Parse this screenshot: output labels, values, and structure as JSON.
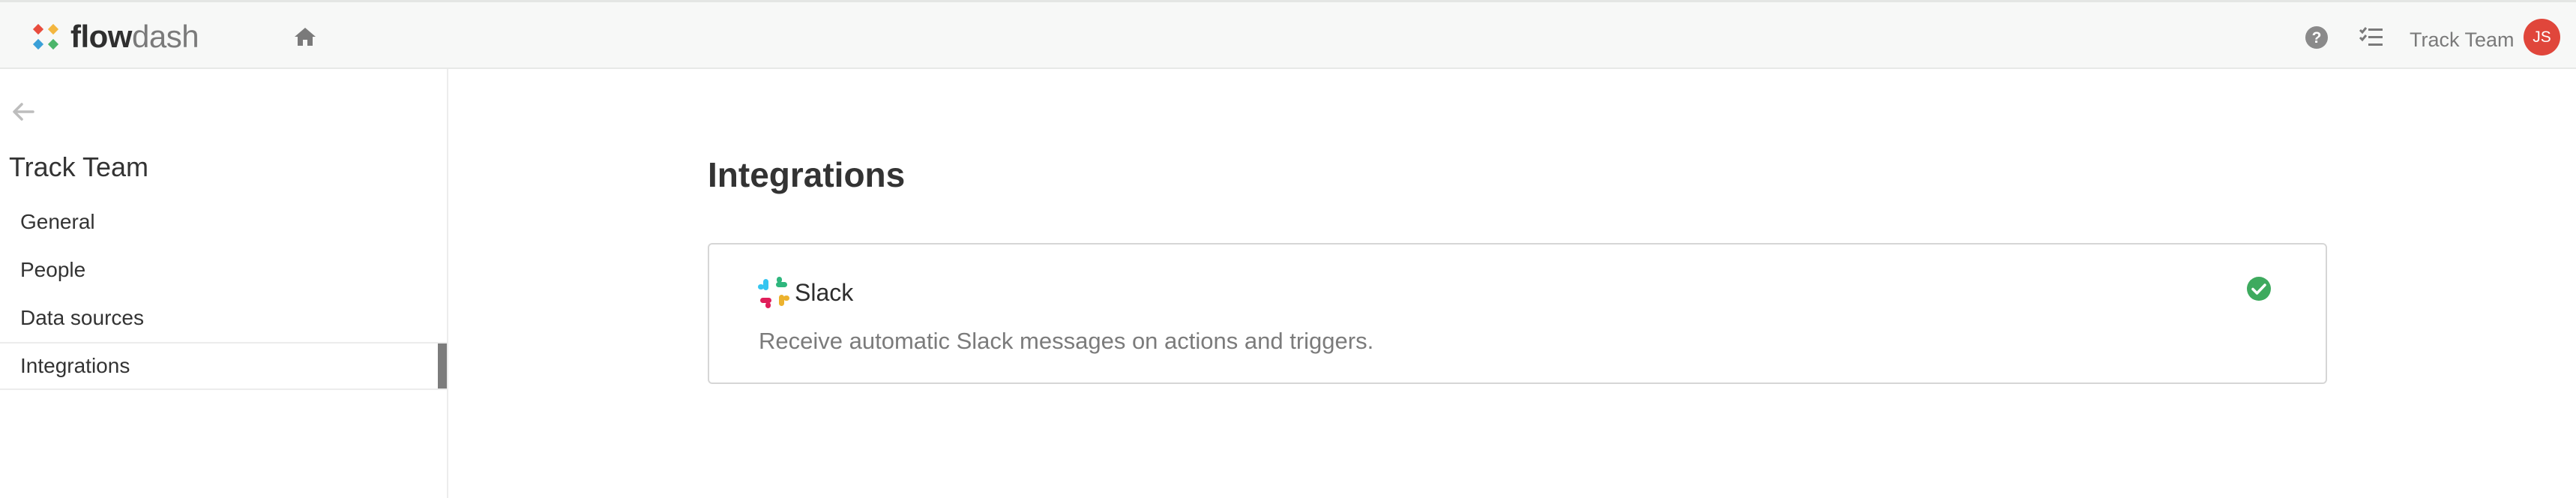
{
  "header": {
    "logo_flow": "flow",
    "logo_dash": "dash",
    "home_icon": "home-icon",
    "help_icon": "help-circle-icon",
    "tasks_icon": "checklist-icon",
    "team_name": "Track Team",
    "avatar_initials": "JS"
  },
  "sidebar": {
    "back_icon": "arrow-left-icon",
    "title": "Track Team",
    "items": [
      {
        "label": "General",
        "active": false
      },
      {
        "label": "People",
        "active": false
      },
      {
        "label": "Data sources",
        "active": false
      },
      {
        "label": "Integrations",
        "active": true
      }
    ]
  },
  "main": {
    "title": "Integrations",
    "integrations": [
      {
        "name": "Slack",
        "icon": "slack-icon",
        "description": "Receive automatic Slack messages on actions and triggers.",
        "status_icon": "check-circle-icon",
        "connected": true
      }
    ]
  },
  "colors": {
    "topbar_bg": "#f7f8f7",
    "avatar": "#e0463b",
    "status_connected": "#3eaa5e",
    "active_marker": "#7c7c7c"
  }
}
